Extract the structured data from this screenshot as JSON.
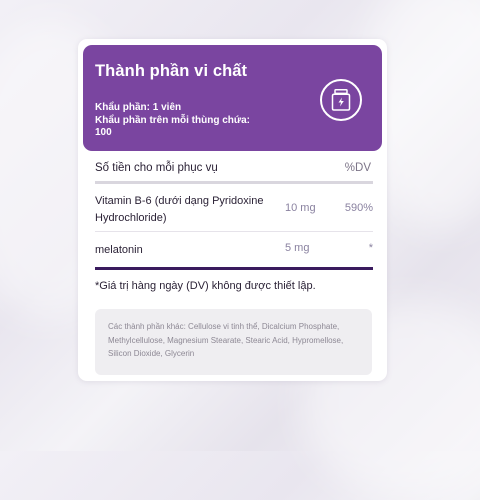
{
  "header": {
    "title": "Thành phần vi chất",
    "serving_size": "Khẩu phần: 1 viên",
    "servings_per_container_label": "Khẩu phần trên mỗi thùng chứa:",
    "servings_per_container_value": "100",
    "icon": "supplement-jar-icon"
  },
  "table": {
    "column_amount_label": "Số tiền cho mỗi phục vụ",
    "column_dv_label": "%DV",
    "rows": [
      {
        "name": "Vitamin B-6 (dưới dạng Pyridoxine Hydrochloride)",
        "amount": "10 mg",
        "dv": "590%"
      },
      {
        "name": "melatonin",
        "amount": "5 mg",
        "dv": "*"
      }
    ]
  },
  "footnote": "*Giá trị hàng ngày (DV) không được thiết lập.",
  "other_ingredients": "Các thành phần khác: Cellulose vi tinh thể, Dicalcium Phosphate, Methylcellulose, Magnesium Stearate, Stearic Acid, Hypromellose, Silicon Dioxide, Glycerin",
  "colors": {
    "header_bg": "#7a45a0",
    "accent_rule": "#3a1b5e",
    "muted_text": "#8a82a0"
  }
}
